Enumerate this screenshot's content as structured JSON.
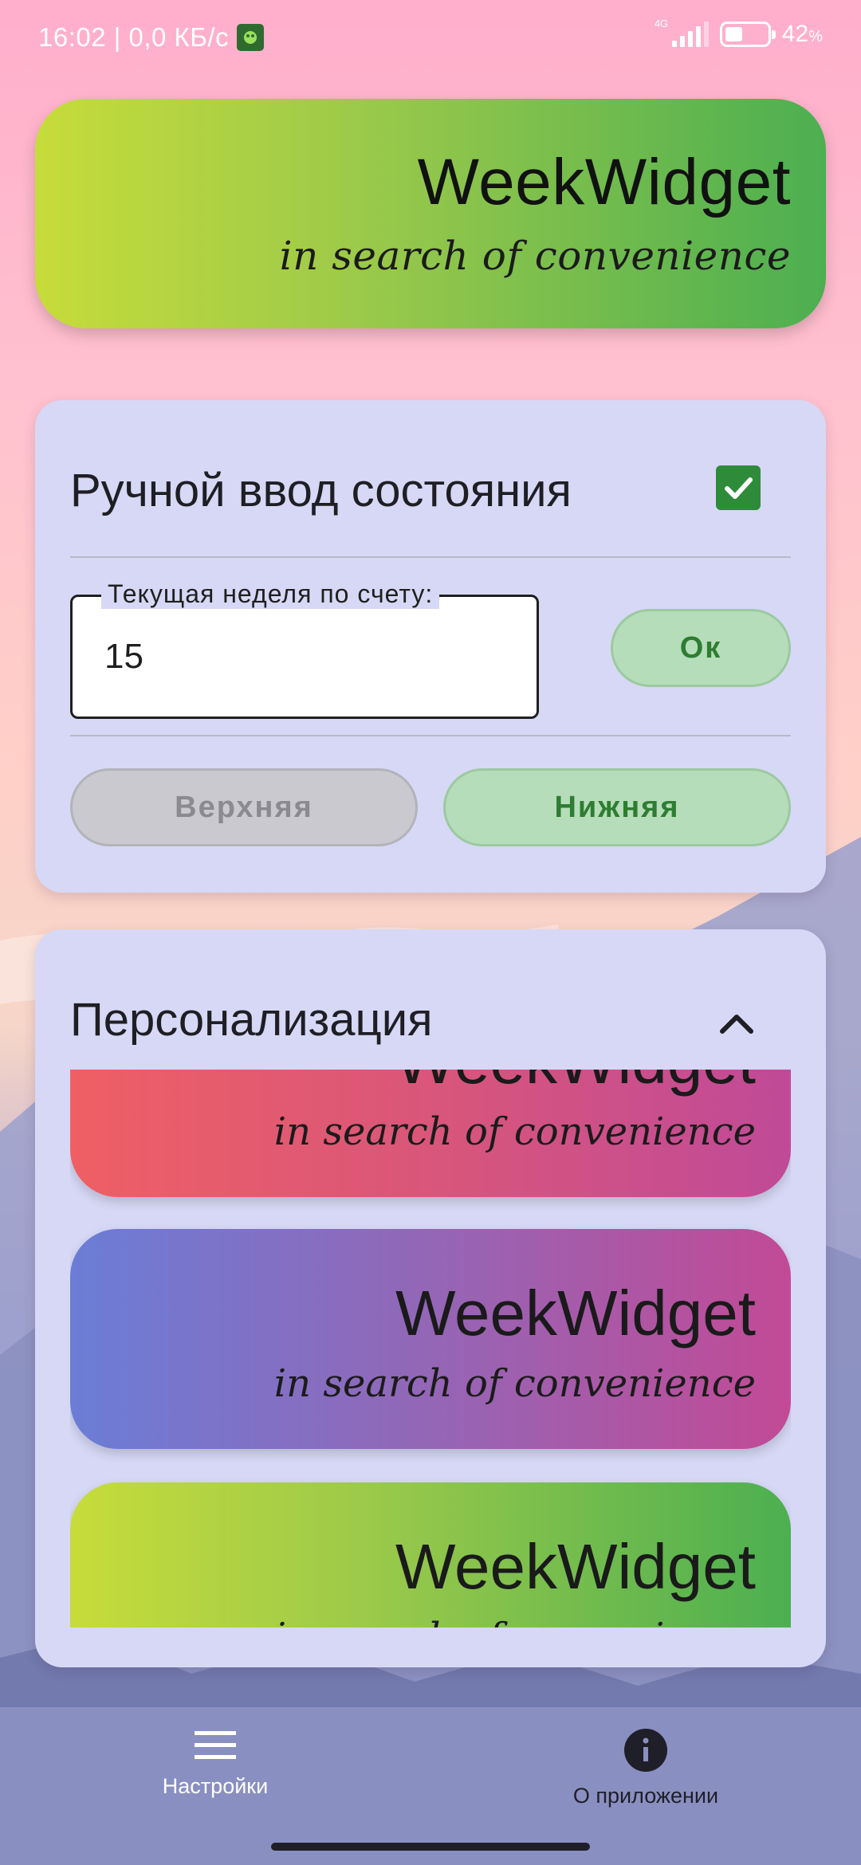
{
  "status_bar": {
    "time_and_speed": "16:02 | 0,0 КБ/с",
    "network": "4G",
    "battery_percent": "42",
    "battery_unit": "%",
    "battery_level": 0.42
  },
  "banner": {
    "title": "WeekWidget",
    "subtitle": "in search of convenience"
  },
  "manual_card": {
    "title": "Ручной ввод состояния",
    "checkbox_checked": true,
    "week_field": {
      "label": "Текущая неделя по счету:",
      "value": "15"
    },
    "ok_label": "Ок",
    "top_label": "Верхняя",
    "bottom_label": "Нижняя"
  },
  "personalization_card": {
    "title": "Персонализация",
    "themes": [
      {
        "title": "WeekWidget",
        "subtitle": "in search of convenience"
      },
      {
        "title": "WeekWidget",
        "subtitle": "in search of convenience"
      },
      {
        "title": "WeekWidget",
        "subtitle": "in search of convenience"
      }
    ]
  },
  "bottom_nav": {
    "settings_label": "Настройки",
    "about_label": "О приложении"
  },
  "colors": {
    "accent_green": "#2e8b3a",
    "card_bg": "#d6d8f5",
    "nav_bg": "#8a8fc1"
  }
}
